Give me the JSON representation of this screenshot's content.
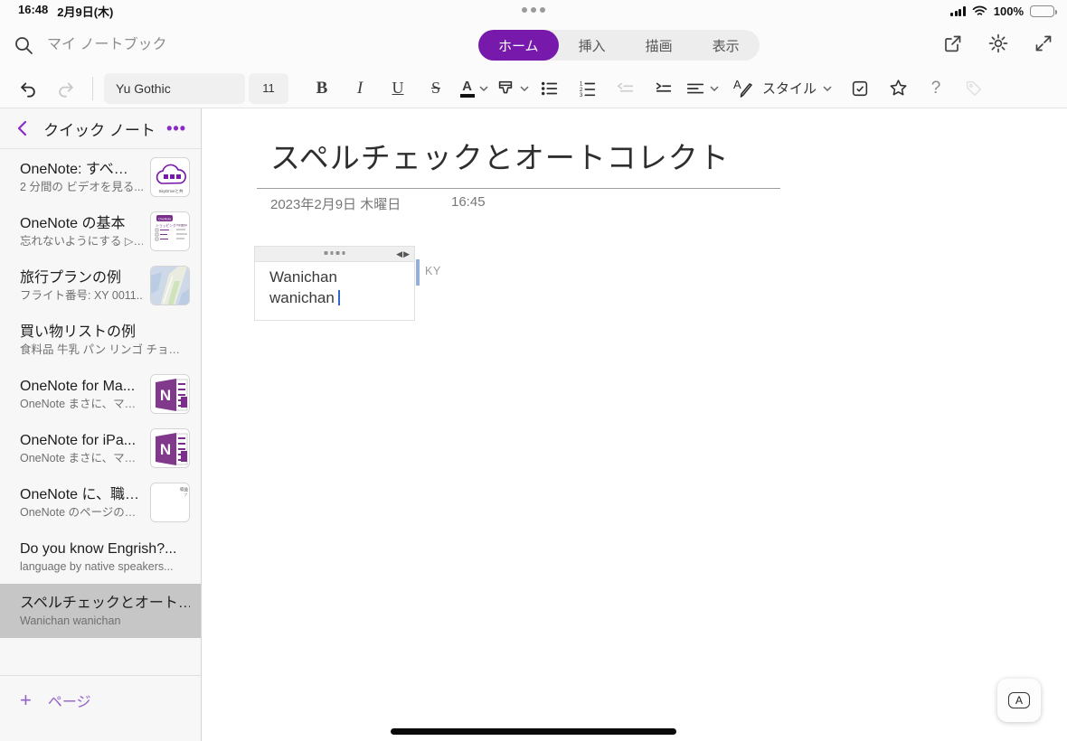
{
  "colors": {
    "accent": "#7719AA",
    "selected_row": "#c6c6c6",
    "battery_green": "#35c75a",
    "author_bar": "#94b0d9"
  },
  "status_bar": {
    "time": "16:48",
    "date": "2月9日(木)",
    "battery_percent": "100%"
  },
  "header": {
    "search_placeholder": "マイ ノートブック",
    "tabs": [
      {
        "label": "ホーム",
        "active": true
      },
      {
        "label": "挿入",
        "active": false
      },
      {
        "label": "描画",
        "active": false
      },
      {
        "label": "表示",
        "active": false
      }
    ]
  },
  "toolbar": {
    "font_name": "Yu Gothic",
    "font_size": "11",
    "style_label": "スタイル",
    "help_label": "?"
  },
  "sidebar": {
    "title": "クイック ノート",
    "more_label": "•••",
    "pages": [
      {
        "title": "OneNote: すべ…",
        "subtitle": "2 分間の ビデオを見る...",
        "thumb": "skydrive-cloud",
        "selected": false
      },
      {
        "title": "OneNote の基本",
        "subtitle": "忘れないようにする ▷…",
        "thumb": "notes-page",
        "selected": false
      },
      {
        "title": "旅行プランの例",
        "subtitle": "フライト番号: XY 0011...",
        "thumb": "map",
        "selected": false
      },
      {
        "title": "買い物リストの例",
        "subtitle": "食料品 牛乳 パン リンゴ チョ…",
        "thumb": null,
        "selected": false
      },
      {
        "title": "OneNote for Ma...",
        "subtitle": "OneNote まさに、マ…",
        "thumb": "onenote-logo",
        "selected": false
      },
      {
        "title": "OneNote for iPa...",
        "subtitle": "OneNote まさに、マ…",
        "thumb": "onenote-logo",
        "selected": false
      },
      {
        "title": "OneNote に、職…",
        "subtitle": "OneNote のページの…",
        "thumb": "document",
        "selected": false
      },
      {
        "title": "Do you know Engrish?...",
        "subtitle": "language by native speakers...",
        "thumb": null,
        "selected": false
      },
      {
        "title": "スペルチェックとオート…",
        "subtitle": "Wanichan  wanichan",
        "thumb": null,
        "selected": true
      }
    ],
    "new_page_label": "ページ"
  },
  "page": {
    "title": "スペルチェックとオートコレクト",
    "date": "2023年2月9日 木曜日",
    "time": "16:45",
    "note": {
      "line1": "Wanichan",
      "line2": "wanichan"
    },
    "author_initials": "KY"
  }
}
